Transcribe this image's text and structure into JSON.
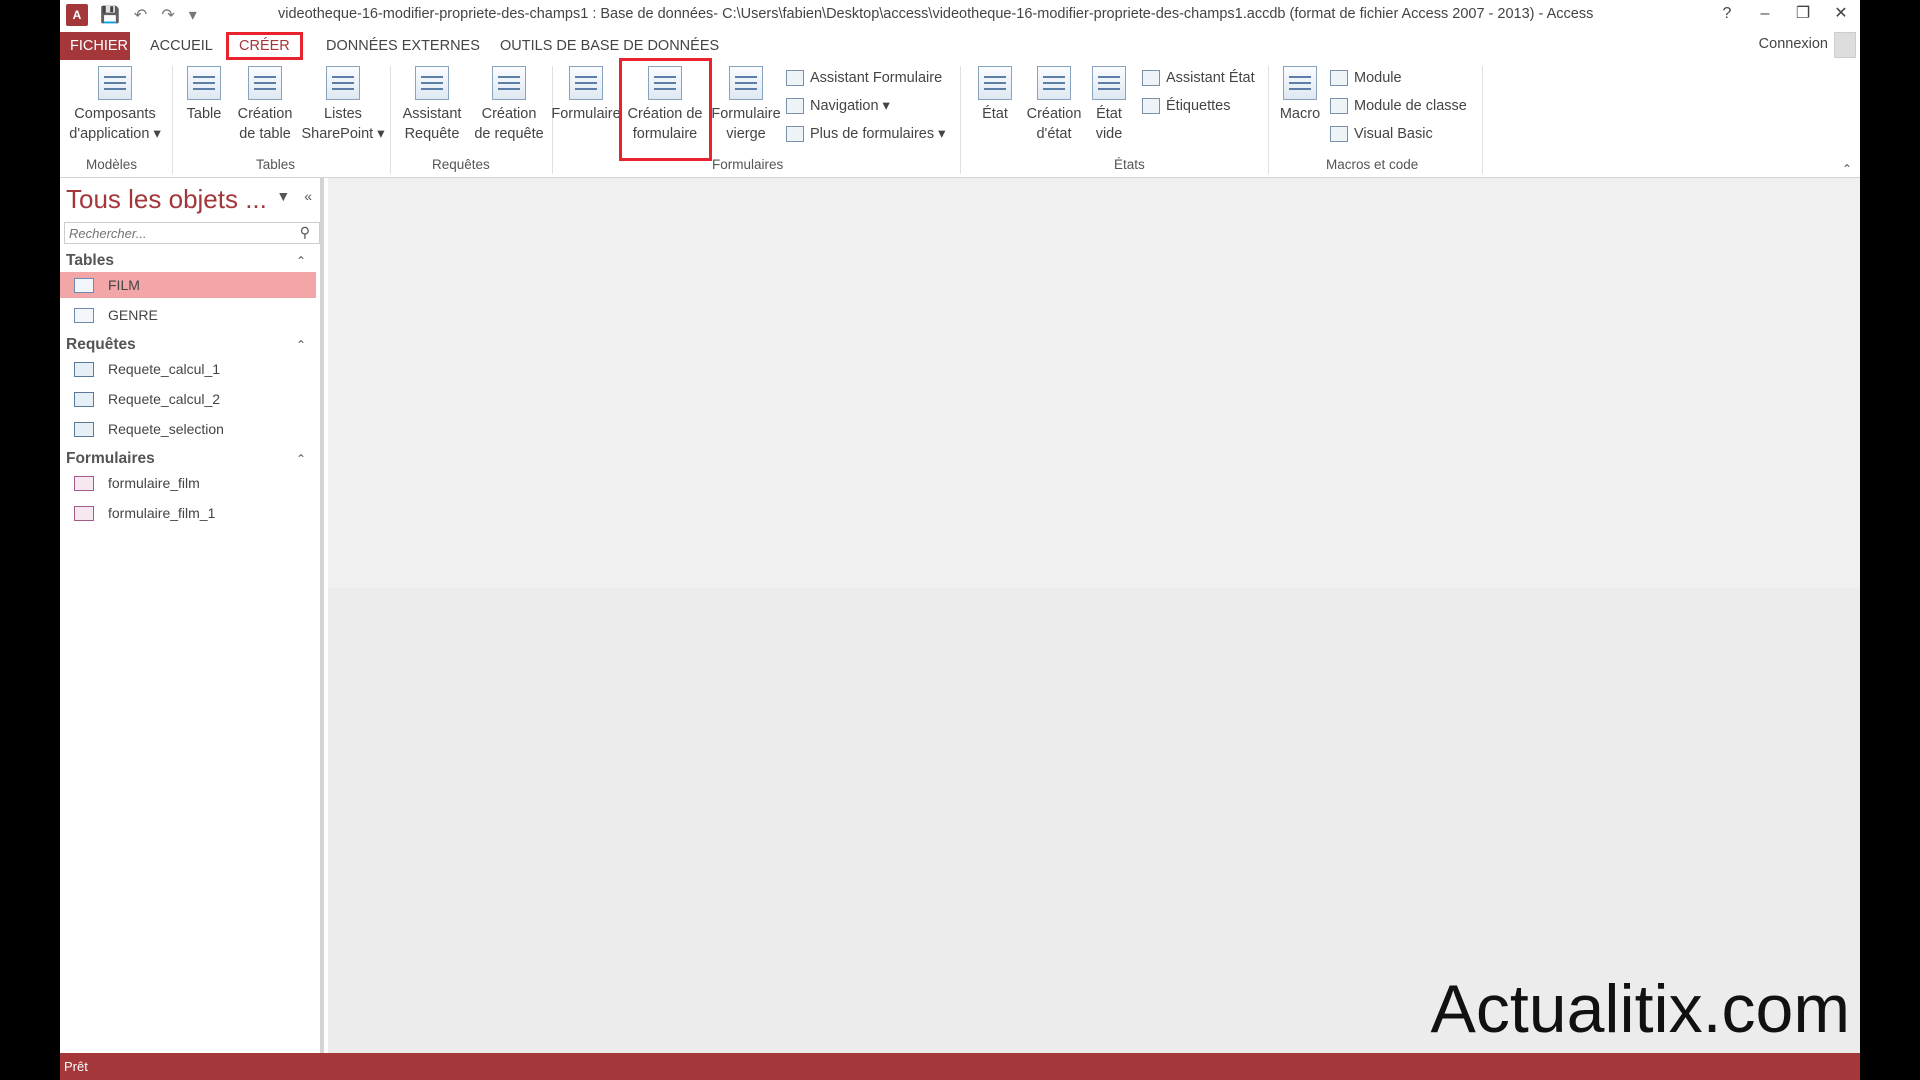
{
  "app": {
    "title": "videotheque-16-modifier-propriete-des-champs1 : Base de données- C:\\Users\\fabien\\Desktop\\access\\videotheque-16-modifier-propriete-des-champs1.accdb (format de fichier Access 2007 - 2013) - Access",
    "logo": "A",
    "accent_color": "#a4373a",
    "highlight_color": "#e8232e"
  },
  "window_controls": {
    "help": "?",
    "minimize": "–",
    "restore": "❐",
    "close": "✕"
  },
  "tabs": [
    {
      "label": "FICHIER"
    },
    {
      "label": "ACCUEIL"
    },
    {
      "label": "CRÉER"
    },
    {
      "label": "DONNÉES EXTERNES"
    },
    {
      "label": "OUTILS DE BASE DE DONNÉES"
    }
  ],
  "user": {
    "signin": "Connexion"
  },
  "ribbon": {
    "groups": {
      "modeles": "Modèles",
      "tables": "Tables",
      "requetes": "Requêtes",
      "formulaires": "Formulaires",
      "etats": "États",
      "macros": "Macros et code"
    },
    "buttons": {
      "composants": [
        "Composants",
        "d'application ▾"
      ],
      "table": [
        "Table"
      ],
      "creation_table": [
        "Création",
        "de table"
      ],
      "listes_sharepoint": [
        "Listes",
        "SharePoint ▾"
      ],
      "assistant_requete": [
        "Assistant",
        "Requête"
      ],
      "creation_requete": [
        "Création",
        "de requête"
      ],
      "formulaire": [
        "Formulaire"
      ],
      "creation_formulaire": [
        "Création de",
        "formulaire"
      ],
      "formulaire_vierge": [
        "Formulaire",
        "vierge"
      ],
      "etat": [
        "État"
      ],
      "creation_etat": [
        "Création",
        "d'état"
      ],
      "etat_vide": [
        "État",
        "vide"
      ],
      "macro": [
        "Macro"
      ]
    },
    "small_buttons": {
      "assistant_formulaire": "Assistant Formulaire",
      "navigation": "Navigation ▾",
      "plus_formulaires": "Plus de formulaires ▾",
      "assistant_etat": "Assistant État",
      "etiquettes": "Étiquettes",
      "module": "Module",
      "module_classe": "Module de classe",
      "visual_basic": "Visual Basic"
    }
  },
  "navpane": {
    "title": "Tous les objets ...",
    "search_placeholder": "Rechercher...",
    "sections": [
      {
        "label": "Tables",
        "items": [
          "FILM",
          "GENRE"
        ]
      },
      {
        "label": "Requêtes",
        "items": [
          "Requete_calcul_1",
          "Requete_calcul_2",
          "Requete_selection"
        ]
      },
      {
        "label": "Formulaires",
        "items": [
          "formulaire_film",
          "formulaire_film_1"
        ]
      }
    ],
    "selected_item": "FILM"
  },
  "watermark": "Actualitix.com",
  "status": {
    "text": "Prêt"
  }
}
